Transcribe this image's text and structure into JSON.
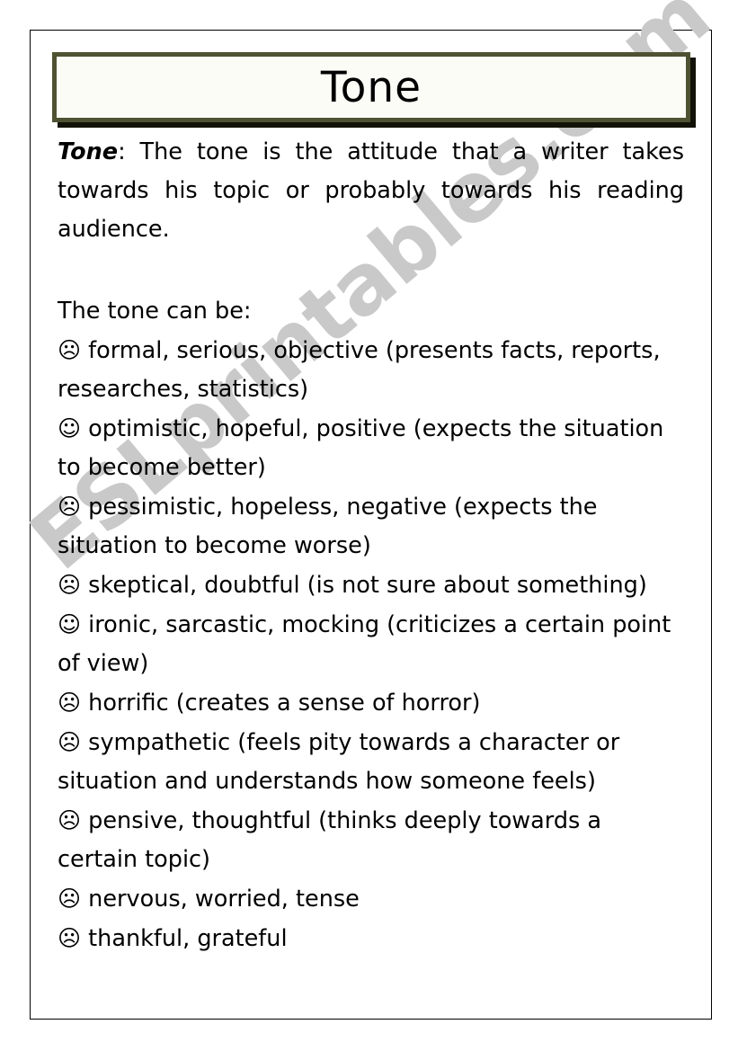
{
  "page": {
    "title": "Tone",
    "frame_color": "#000000",
    "title_box": {
      "border_color": "#4e5232",
      "shadow_color": "#121208",
      "fill_color": "#fcfcf7"
    }
  },
  "watermark": {
    "text": "ESLprintables.com",
    "color": "#c9c9c9"
  },
  "intro": {
    "term": "Tone",
    "definition": ": The tone is the attitude that a writer takes towards his topic or probably towards his reading audience."
  },
  "lead_in": "The tone can be:",
  "icons": {
    "neutral": "☹",
    "smile": "☺",
    "frown": "☹"
  },
  "tone_items": [
    {
      "face": "neutral-face-icon",
      "glyph": "☹",
      "spacer": " ",
      "text": "formal, serious, objective (presents facts, reports, researches, statistics)"
    },
    {
      "face": "smiling-face-icon",
      "glyph": "☺",
      "spacer": " ",
      "text": "optimistic, hopeful, positive (expects the situation to become better)"
    },
    {
      "face": "frowning-face-icon",
      "glyph": "☹",
      "spacer": "  ",
      "text": "pessimistic, hopeless, negative (expects the situation to become worse)"
    },
    {
      "face": "neutral-face-icon",
      "glyph": "☹",
      "spacer": " ",
      "text": "skeptical, doubtful (is not sure about something)"
    },
    {
      "face": "smiling-face-icon",
      "glyph": "☺",
      "spacer": "  ",
      "text": "ironic, sarcastic, mocking (criticizes a certain point of view)"
    },
    {
      "face": "frowning-face-icon",
      "glyph": "☹",
      "spacer": "  ",
      "text": "horrific (creates a sense of horror)"
    },
    {
      "face": "frowning-face-icon",
      "glyph": "☹",
      "spacer": " ",
      "text": "sympathetic (feels pity towards a character or situation and understands how someone feels)"
    },
    {
      "face": "neutral-face-icon",
      "glyph": "☹",
      "spacer": "  ",
      "text": "pensive, thoughtful (thinks deeply towards a certain topic)"
    },
    {
      "face": "frowning-face-icon",
      "glyph": "☹",
      "spacer": " ",
      "text": "nervous, worried, tense"
    },
    {
      "face": "neutral-face-icon",
      "glyph": "☹",
      "spacer": " ",
      "text": "thankful, grateful"
    }
  ]
}
